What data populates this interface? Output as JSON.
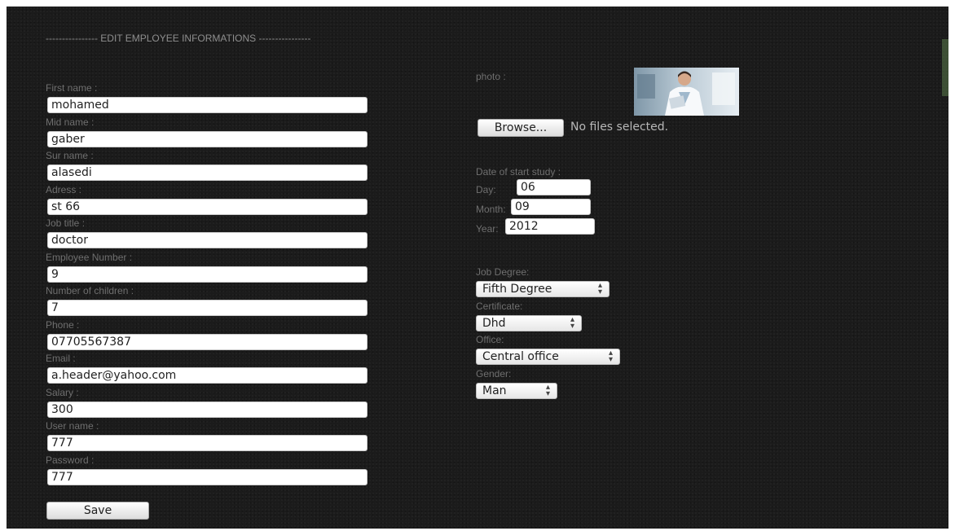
{
  "form": {
    "title": "---------------- EDIT EMPLOYEE INFORMATIONS ----------------",
    "fields": {
      "first_name": {
        "label": "First name :",
        "value": "mohamed"
      },
      "mid_name": {
        "label": "Mid name :",
        "value": "gaber"
      },
      "sur_name": {
        "label": "Sur name :",
        "value": "alasedi"
      },
      "address": {
        "label": "Adress :",
        "value": "st 66"
      },
      "job_title": {
        "label": "Job title :",
        "value": "doctor"
      },
      "employee_number": {
        "label": "Employee Number :",
        "value": "9"
      },
      "children": {
        "label": "Number of children :",
        "value": "7"
      },
      "phone": {
        "label": "Phone :",
        "value": "07705567387"
      },
      "email": {
        "label": "Email :",
        "value": "a.header@yahoo.com"
      },
      "salary": {
        "label": "Salary :",
        "value": "300"
      },
      "user_name": {
        "label": "User name :",
        "value": "777"
      },
      "password": {
        "label": "Password :",
        "value": "777"
      }
    },
    "save_label": "Save"
  },
  "photo": {
    "label": "photo :",
    "browse_label": "Browse...",
    "no_file_text": "No files selected."
  },
  "start_study": {
    "label": "Date of start study :",
    "day_label": "Day:",
    "day": "06",
    "month_label": "Month:",
    "month": "09",
    "year_label": "Year:",
    "year": "2012"
  },
  "selects": {
    "job_degree": {
      "label": "Job Degree:",
      "value": "Fifth Degree"
    },
    "certificate": {
      "label": "Certificate:",
      "value": "Dhd"
    },
    "office": {
      "label": "Office:",
      "value": "Central office"
    },
    "gender": {
      "label": "Gender:",
      "value": "Man"
    }
  },
  "colors": {
    "background": "#1b1b1b",
    "label_text": "#6f6f6f",
    "input_bg": "#ffffff"
  }
}
